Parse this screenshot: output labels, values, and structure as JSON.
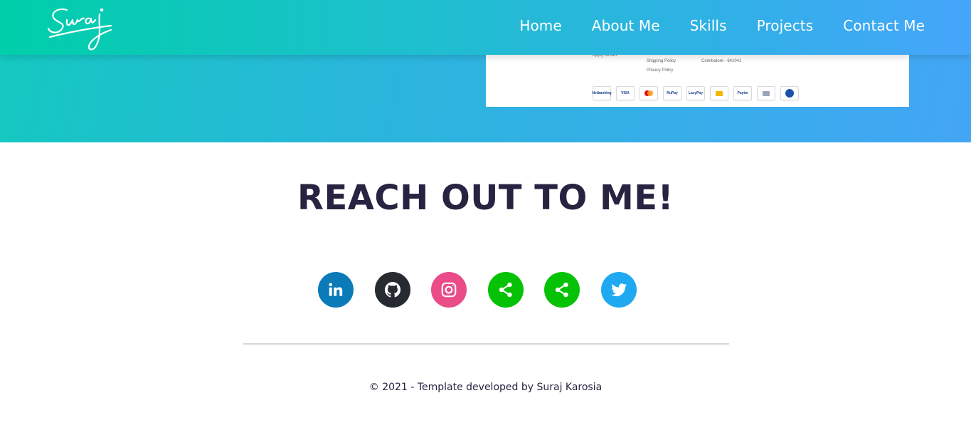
{
  "brand": {
    "logo_text": "Suraj"
  },
  "nav": {
    "items": [
      {
        "label": "Home"
      },
      {
        "label": "About Me"
      },
      {
        "label": "Skills"
      },
      {
        "label": "Projects"
      },
      {
        "label": "Contact Me"
      }
    ]
  },
  "project_preview": {
    "footer_links": [
      "Apply for API",
      "Shipping Policy",
      "Privacy Policy"
    ],
    "address": "Coimbatore - 641041",
    "payment_icons": [
      "Netbanking",
      "VISA",
      "mastercard",
      "RuPay",
      "LazyPay",
      "wallet",
      "Paytm",
      "wallet",
      "Amex"
    ]
  },
  "contact": {
    "title": "REACH OUT TO ME!",
    "socials": [
      {
        "name": "linkedin",
        "icon": "linkedin-icon",
        "color": "#0a7bb8"
      },
      {
        "name": "github",
        "icon": "github-icon",
        "color": "#272b31"
      },
      {
        "name": "instagram",
        "icon": "instagram-icon",
        "color": "#ea4c89"
      },
      {
        "name": "share-1",
        "icon": "share-icon",
        "color": "#06c206"
      },
      {
        "name": "share-2",
        "icon": "share-icon",
        "color": "#06c206"
      },
      {
        "name": "twitter",
        "icon": "twitter-icon",
        "color": "#1fa9f0"
      }
    ]
  },
  "footer": {
    "text": "© 2021 - Template developed by Suraj Karosia"
  },
  "colors": {
    "heading": "#272341",
    "divider": "#d6d6d6",
    "gradient_start": "#00cfaa",
    "gradient_end": "#46a5fb"
  }
}
